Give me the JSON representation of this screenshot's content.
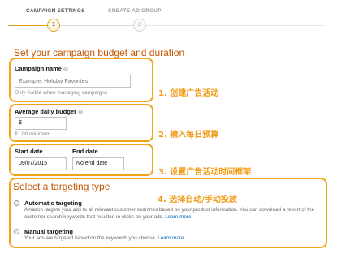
{
  "stepper": {
    "steps": [
      {
        "label": "CAMPAIGN SETTINGS",
        "number": "1",
        "active": true
      },
      {
        "label": "CREATE AD GROUP",
        "number": "2",
        "active": false
      }
    ]
  },
  "budget_section": {
    "title": "Set your campaign budget and duration"
  },
  "campaign_name": {
    "label": "Campaign name",
    "placeholder": "Example: Holiday Favorites",
    "hint": "Only visible when managing campaigns",
    "annotation": "1. 创建广告活动"
  },
  "daily_budget": {
    "label": "Average daily budget",
    "value": "$",
    "hint": "$1.00 minimum",
    "annotation": "2. 输入每日预算"
  },
  "dates": {
    "start_label": "Start date",
    "start_value": "09/07/2015",
    "end_label": "End date",
    "end_value": "No end date",
    "annotation": "3. 设置广告活动时间框架"
  },
  "targeting": {
    "title": "Select a targeting type",
    "annotation": "4. 选择自动/手动投放",
    "options": [
      {
        "label": "Automatic targeting",
        "description": "Amazon targets your ads to all relevant customer searches based on your product information. You can download a report of the customer search keywords that resulted in clicks on your ads.",
        "link": "Learn more"
      },
      {
        "label": "Manual targeting",
        "description": "Your ads are targeted based on the keywords you choose.",
        "link": "Learn more"
      }
    ]
  },
  "colors": {
    "accent": "#f3a317",
    "heading": "#c45500",
    "link": "#0066c0"
  }
}
